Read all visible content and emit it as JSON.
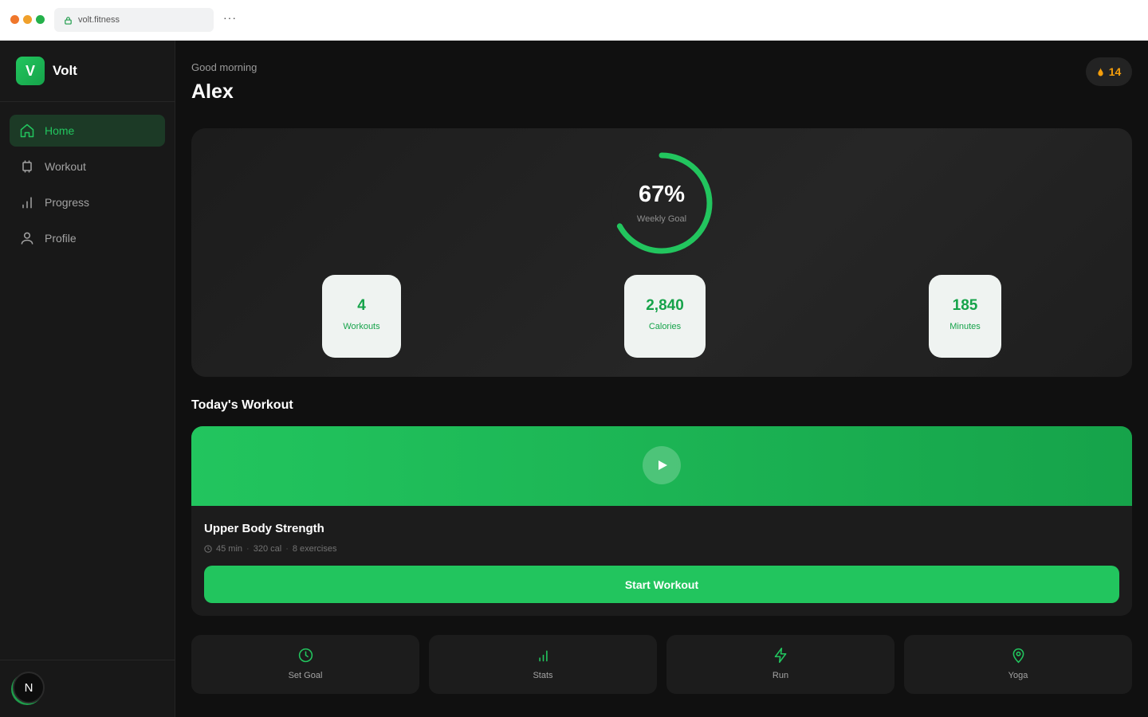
{
  "browser": {
    "url": "volt.fitness",
    "more": "···"
  },
  "brand": {
    "logo_letter": "V",
    "name": "Volt"
  },
  "nav": [
    {
      "label": "Home",
      "icon": "home-icon",
      "active": true
    },
    {
      "label": "Workout",
      "icon": "dumbbell-icon",
      "active": false
    },
    {
      "label": "Progress",
      "icon": "bar-chart-icon",
      "active": false
    },
    {
      "label": "Profile",
      "icon": "user-icon",
      "active": false
    }
  ],
  "avatar": {
    "letter": "N"
  },
  "header": {
    "greeting": "Good morning",
    "name": "Alex",
    "streak": "14"
  },
  "goal": {
    "percent": "67%",
    "progress": 0.67,
    "label": "Weekly Goal"
  },
  "stats": [
    {
      "value": "4",
      "label": "Workouts"
    },
    {
      "value": "2,840",
      "label": "Calories"
    },
    {
      "value": "185",
      "label": "Minutes"
    }
  ],
  "today": {
    "section_title": "Today's Workout",
    "title": "Upper Body Strength",
    "duration": "45 min",
    "calories": "320 cal",
    "exercises": "8 exercises",
    "button": "Start Workout"
  },
  "quick_actions": [
    {
      "label": "Set Goal",
      "icon": "clock-icon"
    },
    {
      "label": "Stats",
      "icon": "bar-chart-icon"
    },
    {
      "label": "Run",
      "icon": "lightning-icon"
    },
    {
      "label": "Yoga",
      "icon": "map-pin-icon"
    }
  ],
  "colors": {
    "accent": "#22c55e",
    "accent_dark": "#16a34a",
    "streak": "#f59e0b",
    "background": "#101010"
  }
}
